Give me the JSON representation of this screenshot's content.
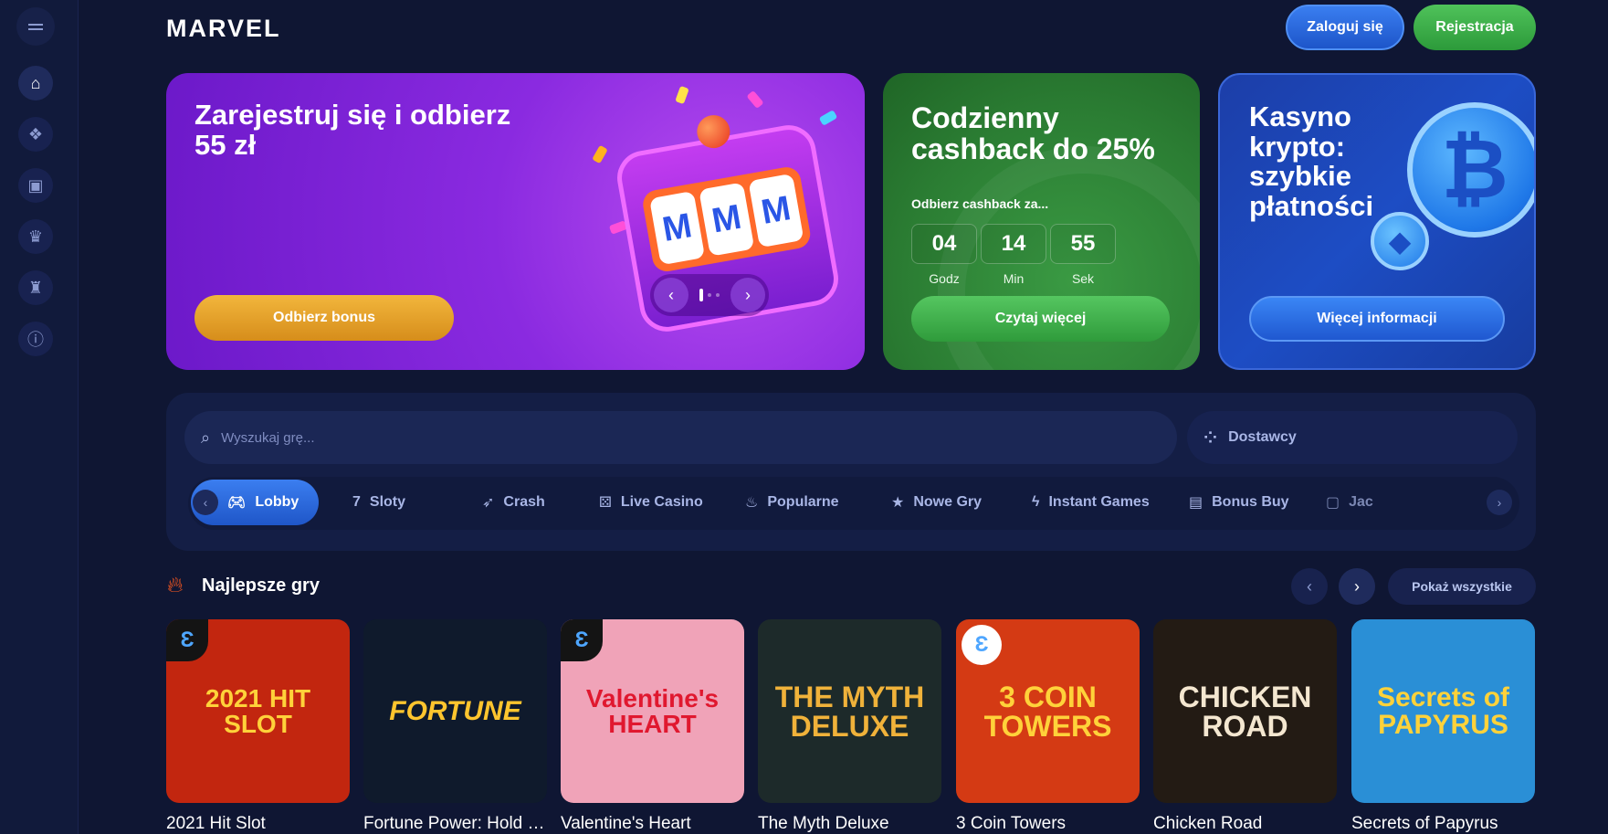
{
  "header": {
    "logo": "MARVEL",
    "login_label": "Zaloguj się",
    "register_label": "Rejestracja"
  },
  "banners": {
    "welcome": {
      "title": "Zarejestruj się i odbierz 55 zł",
      "button": "Odbierz bonus",
      "reels": [
        "M",
        "M",
        "M"
      ]
    },
    "cashback": {
      "title": "Codzienny cashback do 25%",
      "subtitle": "Odbierz cashback za...",
      "countdown": [
        {
          "value": "04",
          "unit": "Godz"
        },
        {
          "value": "14",
          "unit": "Min"
        },
        {
          "value": "55",
          "unit": "Sek"
        }
      ],
      "button": "Czytaj więcej"
    },
    "crypto": {
      "title": "Kasyno krypto: szybkie płatności",
      "button": "Więcej informacji"
    }
  },
  "search": {
    "placeholder": "Wyszukaj grę...",
    "providers_label": "Dostawcy"
  },
  "tabs": [
    {
      "label": "Lobby",
      "icon": "gamepad-icon",
      "active": true
    },
    {
      "label": "Sloty",
      "icon": "slots-icon"
    },
    {
      "label": "Crash",
      "icon": "rocket-icon"
    },
    {
      "label": "Live Casino",
      "icon": "dice-icon"
    },
    {
      "label": "Popularne",
      "icon": "flame-icon"
    },
    {
      "label": "Nowe Gry",
      "icon": "star-icon"
    },
    {
      "label": "Instant Games",
      "icon": "lightning-icon"
    },
    {
      "label": "Bonus Buy",
      "icon": "ticket-icon"
    },
    {
      "label": "Jac",
      "icon": "jackpot-icon"
    }
  ],
  "section": {
    "title": "Najlepsze gry",
    "show_all": "Pokaż wszystkie"
  },
  "games": [
    {
      "name": "2021 Hit Slot",
      "art": "2021 HIT SLOT",
      "bg": "#c2260f",
      "fg": "#ffd23a"
    },
    {
      "name": "Fortune Power: Hold & Win",
      "art": "FORTUNE",
      "bg": "#0f1a2c",
      "fg": "#ffc52e"
    },
    {
      "name": "Valentine's Heart",
      "art": "Valentine's HEART",
      "bg": "#f0a3b8",
      "fg": "#e0182f"
    },
    {
      "name": "The Myth Deluxe",
      "art": "THE MYTH DELUXE",
      "bg": "#1d2a2a",
      "fg": "#f0b23a"
    },
    {
      "name": "3 Coin Towers",
      "art": "3 COIN TOWERS",
      "bg": "#d43a14",
      "fg": "#ffd23a"
    },
    {
      "name": "Chicken Road",
      "art": "CHICKEN ROAD",
      "bg": "#231b14",
      "fg": "#f4e7d0"
    },
    {
      "name": "Secrets of Papyrus",
      "art": "Secrets of PAPYRUS",
      "bg": "#2a8fd6",
      "fg": "#ffd23a"
    }
  ],
  "colors": {
    "background": "#0f1633",
    "accent_blue": "#2b6be0",
    "accent_green": "#3caa45",
    "accent_orange": "#e9a02a"
  }
}
